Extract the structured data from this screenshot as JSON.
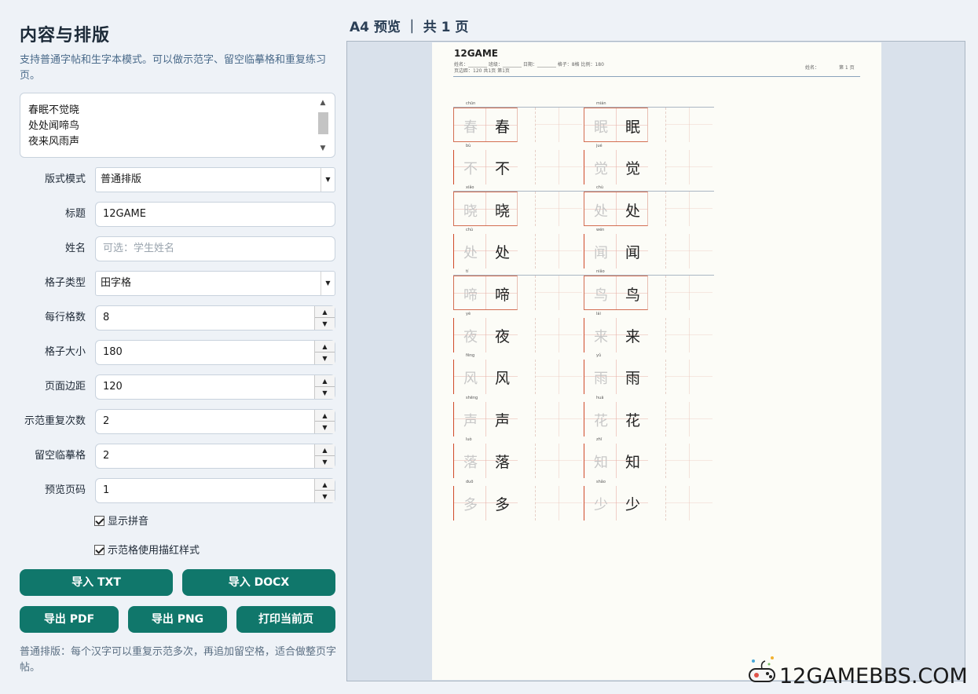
{
  "left_panel": {
    "title": "内容与排版",
    "description": "支持普通字帖和生字本模式。可以做示范字、留空临摹格和重复练习页。",
    "textarea_lines": [
      "春眠不觉晓",
      "处处闻啼鸟",
      "夜来风雨声"
    ],
    "fields": {
      "layout_mode": {
        "label": "版式模式",
        "value": "普通排版"
      },
      "title": {
        "label": "标题",
        "value": "12GAME"
      },
      "name": {
        "label": "姓名",
        "placeholder": "可选：学生姓名"
      },
      "grid_type": {
        "label": "格子类型",
        "value": "田字格"
      },
      "per_row": {
        "label": "每行格数",
        "value": "8"
      },
      "cell_size": {
        "label": "格子大小",
        "value": "180"
      },
      "page_margin": {
        "label": "页面边距",
        "value": "120"
      },
      "demo_repeat": {
        "label": "示范重复次数",
        "value": "2"
      },
      "blank_cells": {
        "label": "留空临摹格",
        "value": "2"
      },
      "preview_page": {
        "label": "预览页码",
        "value": "1"
      }
    },
    "checkboxes": {
      "show_pinyin": "显示拼音",
      "trace_style": "示范格使用描红样式"
    },
    "buttons": {
      "import_txt": "导入 TXT",
      "import_docx": "导入 DOCX",
      "export_pdf": "导出 PDF",
      "export_png": "导出 PNG",
      "print_page": "打印当前页"
    },
    "footnote": "普通排版：每个汉字可以重复示范多次，再追加留空格，适合做整页字帖。"
  },
  "preview": {
    "header": "A4 预览 ｜ 共 1 页",
    "page": {
      "title": "12GAME",
      "meta_line1": "姓名：________  班级：________  日期：________  格子：8格  比例：180",
      "meta_line2": "页边距：120  共1页  第1页",
      "meta_right": "姓名：",
      "meta_page": "第 1 页",
      "characters": [
        {
          "char": "春",
          "pinyin": "chūn"
        },
        {
          "char": "眠",
          "pinyin": "mián"
        },
        {
          "char": "不",
          "pinyin": "bù"
        },
        {
          "char": "觉",
          "pinyin": "jué"
        },
        {
          "char": "晓",
          "pinyin": "xiǎo"
        },
        {
          "char": "处",
          "pinyin": "chù"
        },
        {
          "char": "处",
          "pinyin": "chù"
        },
        {
          "char": "闻",
          "pinyin": "wén"
        },
        {
          "char": "啼",
          "pinyin": "tí"
        },
        {
          "char": "鸟",
          "pinyin": "niǎo"
        },
        {
          "char": "夜",
          "pinyin": "yè"
        },
        {
          "char": "来",
          "pinyin": "lái"
        },
        {
          "char": "风",
          "pinyin": "fēng"
        },
        {
          "char": "雨",
          "pinyin": "yǔ"
        },
        {
          "char": "声",
          "pinyin": "shēng"
        },
        {
          "char": "花",
          "pinyin": "huā"
        },
        {
          "char": "落",
          "pinyin": "luò"
        },
        {
          "char": "知",
          "pinyin": "zhī"
        },
        {
          "char": "多",
          "pinyin": "duō"
        },
        {
          "char": "少",
          "pinyin": "shǎo"
        }
      ]
    }
  },
  "watermark": {
    "text": "12GAMEBBS.COM",
    "icon": "gamepad-icon"
  },
  "colors": {
    "accent": "#10776b",
    "title": "#1c2a38",
    "grid_red": "#d04a2a"
  }
}
